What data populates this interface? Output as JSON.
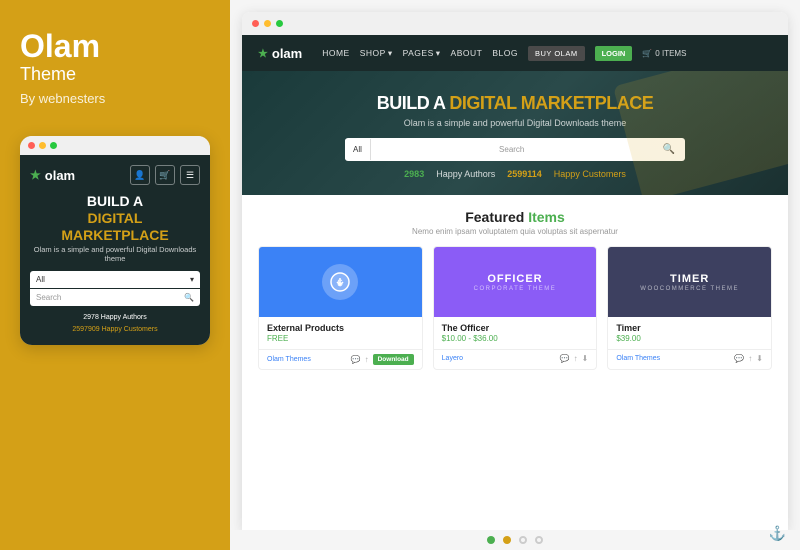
{
  "left": {
    "brand": "Olam",
    "subtitle": "Theme",
    "by": "By webnesters",
    "mobile": {
      "logo": "olam",
      "hero_line1": "BUILD A",
      "hero_line2": "DIGITAL",
      "hero_line3": "MARKETPLACE",
      "hero_sub": "Olam is a simple and powerful Digital Downloads theme",
      "search_all_label": "All",
      "search_placeholder": "Search",
      "stats_authors_num": "2978",
      "stats_authors_label": "Happy Authors",
      "stats_customers_num": "2597909",
      "stats_customers_label": "Happy Customers"
    }
  },
  "right": {
    "nav": {
      "logo": "olam",
      "links": [
        "HOME",
        "SHOP",
        "PAGES",
        "ABOUT",
        "BLOG",
        "BUY OLAM"
      ],
      "login": "LOGIN",
      "cart": "0 ITEMS"
    },
    "hero": {
      "title_line1": "BUILD A",
      "title_highlight": "DIGITAL MARKETPLACE",
      "sub": "Olam is a simple and powerful Digital Downloads theme",
      "search_all": "All",
      "search_placeholder": "Search",
      "authors_num": "2983",
      "authors_label": "Happy Authors",
      "customers_num": "2599114",
      "customers_label": "Happy Customers"
    },
    "featured": {
      "title": "Featured",
      "title_highlight": "Items",
      "sub": "Nemo enim ipsam voluptatem quia voluptas sit aspernatur",
      "products": [
        {
          "name": "External Products",
          "price": "FREE",
          "author": "Olam Themes",
          "thumb_type": "blue",
          "thumb_icon": "⬆",
          "action_label": "Download"
        },
        {
          "name": "The Officer",
          "price": "$10.00 - $36.00",
          "author": "Layero",
          "thumb_type": "purple",
          "thumb_text": "OFFICER",
          "thumb_sub": "CORPORATE THEME",
          "action_label": ""
        },
        {
          "name": "Timer",
          "price": "$39.00",
          "author": "Olam Themes",
          "thumb_type": "dark",
          "thumb_text": "TIMER",
          "thumb_sub": "Woocommerce Theme",
          "action_label": ""
        }
      ]
    },
    "bottom_dots": [
      "teal",
      "yellow",
      "outline",
      "outline"
    ]
  }
}
